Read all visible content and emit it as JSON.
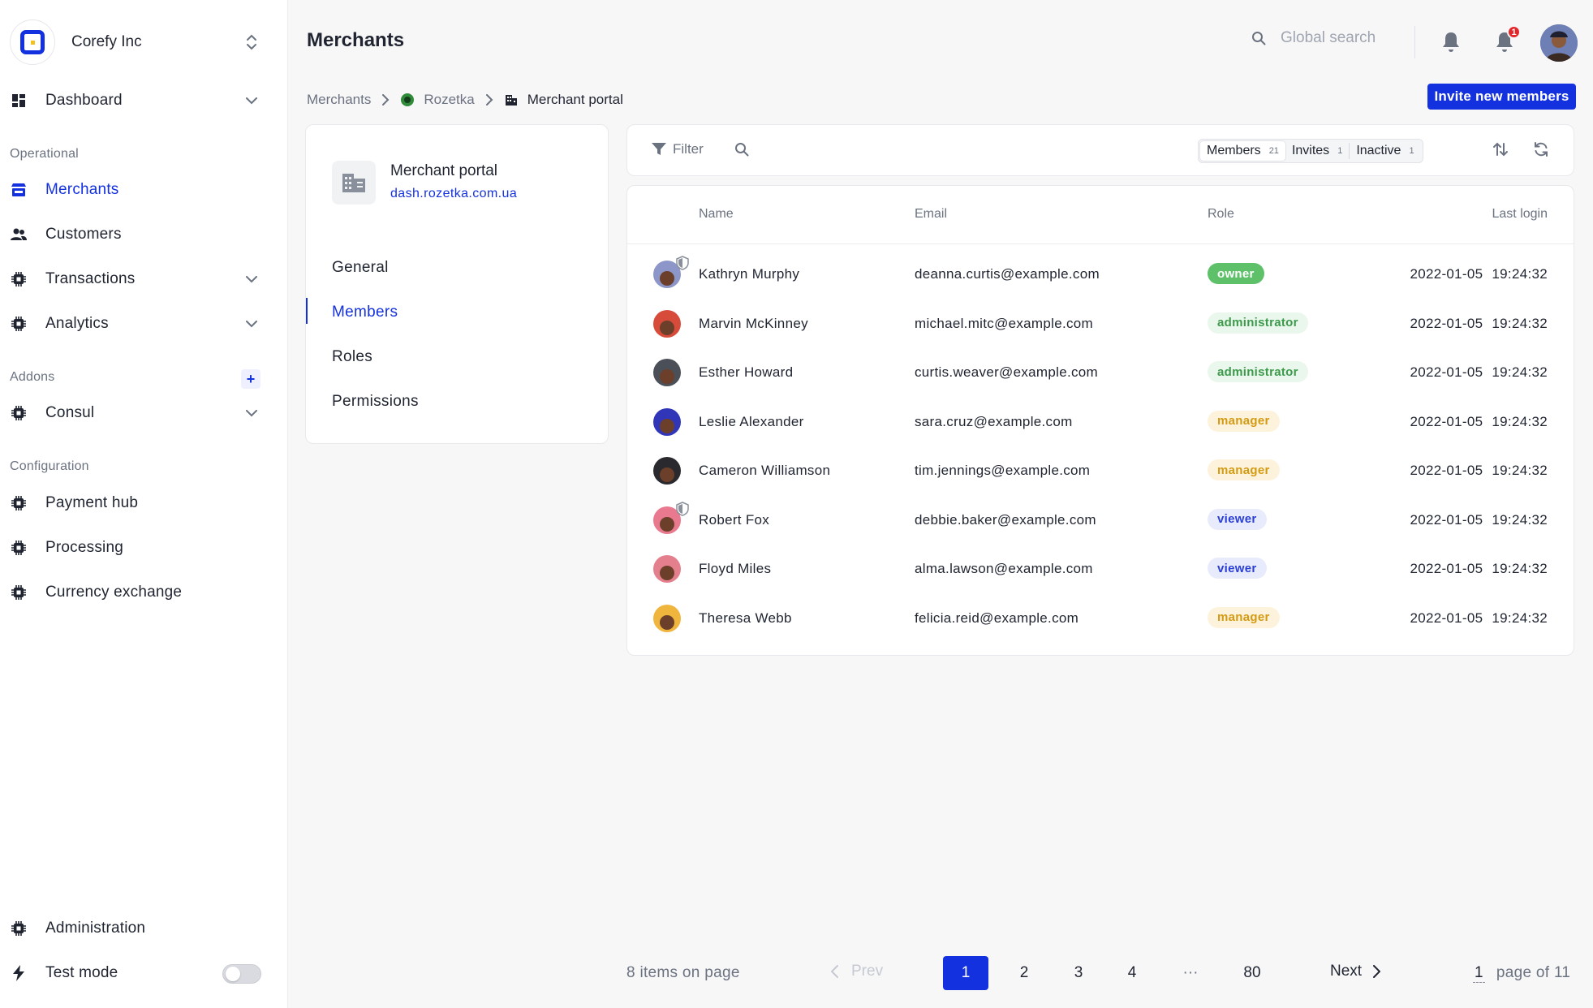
{
  "org": {
    "name": "Corefy Inc"
  },
  "sidebar": {
    "dashboard": "Dashboard",
    "sections": {
      "operational": "Operational",
      "addons": "Addons",
      "configuration": "Configuration"
    },
    "items": {
      "merchants": "Merchants",
      "customers": "Customers",
      "transactions": "Transactions",
      "analytics": "Analytics",
      "consul": "Consul",
      "payment_hub": "Payment hub",
      "processing": "Processing",
      "currency_exchange": "Currency exchange",
      "administration": "Administration",
      "test_mode": "Test mode"
    },
    "test_mode_on": false
  },
  "header": {
    "title": "Merchants",
    "search_placeholder": "Global search",
    "notifications_badge": "1"
  },
  "breadcrumb": {
    "root": "Merchants",
    "merchant": "Rozetka",
    "current": "Merchant portal"
  },
  "invite_button": "Invite new members",
  "portal": {
    "name": "Merchant portal",
    "url": "dash.rozetka.com.ua",
    "nav": [
      "General",
      "Members",
      "Roles",
      "Permissions"
    ],
    "active_nav": "Members"
  },
  "toolbar": {
    "filter": "Filter",
    "segments": [
      {
        "label": "Members",
        "count": "21"
      },
      {
        "label": "Invites",
        "count": "1"
      },
      {
        "label": "Inactive",
        "count": "1"
      }
    ]
  },
  "table": {
    "columns": {
      "name": "Name",
      "email": "Email",
      "role": "Role",
      "last_login": "Last login"
    },
    "rows": [
      {
        "name": "Kathryn Murphy",
        "email": "deanna.curtis@example.com",
        "role": "owner",
        "last_login": "2022-01-05 19:24:32",
        "shield": true
      },
      {
        "name": "Marvin McKinney",
        "email": "michael.mitc@example.com",
        "role": "administrator",
        "last_login": "2022-01-05 19:24:32",
        "shield": false
      },
      {
        "name": "Esther Howard",
        "email": "curtis.weaver@example.com",
        "role": "administrator",
        "last_login": "2022-01-05 19:24:32",
        "shield": false
      },
      {
        "name": "Leslie Alexander",
        "email": "sara.cruz@example.com",
        "role": "manager",
        "last_login": "2022-01-05 19:24:32",
        "shield": false
      },
      {
        "name": "Cameron Williamson",
        "email": "tim.jennings@example.com",
        "role": "manager",
        "last_login": "2022-01-05 19:24:32",
        "shield": false
      },
      {
        "name": "Robert Fox",
        "email": "debbie.baker@example.com",
        "role": "viewer",
        "last_login": "2022-01-05 19:24:32",
        "shield": true
      },
      {
        "name": "Floyd Miles",
        "email": "alma.lawson@example.com",
        "role": "viewer",
        "last_login": "2022-01-05 19:24:32",
        "shield": false
      },
      {
        "name": "Theresa Webb",
        "email": "felicia.reid@example.com",
        "role": "manager",
        "last_login": "2022-01-05 19:24:32",
        "shield": false
      }
    ]
  },
  "role_colors": {
    "owner": {
      "bg": "#5ec16a",
      "fg": "#ffffff"
    },
    "administrator": {
      "bg": "#eaf7ec",
      "fg": "#3d9a4b"
    },
    "manager": {
      "bg": "#fdf3dc",
      "fg": "#d49a12"
    },
    "viewer": {
      "bg": "#e8ebfb",
      "fg": "#2a3fd6"
    }
  },
  "avatar_colors": [
    "#8d96c8",
    "#d64b3a",
    "#4b4f57",
    "#3136b8",
    "#2a2a2e",
    "#e8798e",
    "#e47f8e",
    "#f0b53d"
  ],
  "pagination": {
    "items_on_page": "8 items on page",
    "prev": "Prev",
    "next": "Next",
    "pages": [
      "1",
      "2",
      "3",
      "4",
      "···",
      "80"
    ],
    "current": "1",
    "page_of": "page of 11"
  },
  "colors": {
    "accent": "#1431e0"
  }
}
